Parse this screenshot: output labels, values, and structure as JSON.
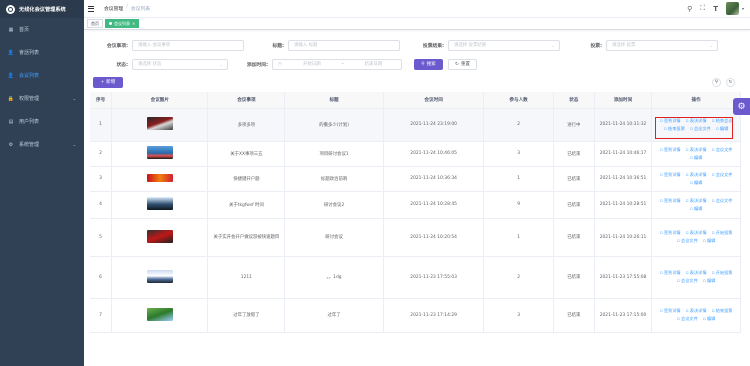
{
  "app": {
    "title": "无线化会议管理系统"
  },
  "sidebar": {
    "items": [
      {
        "label": "首页",
        "icon": "dashboard-icon"
      },
      {
        "label": "會話列表",
        "icon": "user-icon"
      },
      {
        "label": "会议列表",
        "icon": "user-icon",
        "active": true
      },
      {
        "label": "权限管理",
        "icon": "lock-icon",
        "expandable": true
      },
      {
        "label": "用户列表",
        "icon": "document-icon"
      },
      {
        "label": "系统管理",
        "icon": "gear-icon",
        "expandable": true
      }
    ]
  },
  "navbar": {
    "breadcrumb": [
      "会议管理",
      "会议列表"
    ]
  },
  "tags": {
    "home": "首页",
    "active": "会议列表"
  },
  "filters": {
    "meeting_label": "会议事项:",
    "meeting_placeholder": "请输入 会议事项",
    "title_label": "标题:",
    "title_placeholder": "请输入 标题",
    "vote_result_label": "投票结果:",
    "vote_result_placeholder": "请选择 投票结果",
    "vote_label": "投票:",
    "vote_placeholder": "请选择 投票",
    "status_label": "状态:",
    "status_placeholder": "请选择 状态",
    "time_label": "添加时间:",
    "start_placeholder": "开始日期",
    "end_placeholder": "结束日期",
    "range_sep": "-",
    "search_label": "搜索",
    "reset_label": "重置"
  },
  "toolbar": {
    "add_label": "+ 新增"
  },
  "table": {
    "headers": [
      "序号",
      "会议图片",
      "会议事项",
      "标题",
      "会议时间",
      "参与人数",
      "状态",
      "添加时间",
      "操作"
    ],
    "rows": [
      {
        "no": "1",
        "thumb": "t1",
        "item": "多项多项",
        "title": "的撒多少(计划)",
        "time": "2021-11-24 23:19:00",
        "count": "2",
        "status": "进行中",
        "added": "2021-11-24 10:31:32",
        "ops": [
          "签到详情",
          "表决详情",
          "结束会议",
          "结束投票",
          "会议文件",
          "编辑"
        ]
      },
      {
        "no": "2",
        "thumb": "t2",
        "item": "关于XX事项三五",
        "title": "项目研讨会议1",
        "time": "2021-11-24 10:46:05",
        "count": "3",
        "status": "已结束",
        "added": "2021-11-24 10:46:17",
        "ops": [
          "签到详情",
          "表决详情",
          "会议文件",
          "编辑"
        ]
      },
      {
        "no": "3",
        "thumb": "t3",
        "item": "快捷键开户题",
        "title": "标题政治前哨",
        "time": "2021-11-24 10:36:34",
        "count": "1",
        "status": "已结束",
        "added": "2021-11-24 10:36:51",
        "ops": [
          "签到详情",
          "表决详情",
          "会议文件",
          "编辑"
        ]
      },
      {
        "no": "4",
        "thumb": "t4",
        "item": "关于tkgfwsf 时间",
        "title": "研讨会议2",
        "time": "2021-11-24 10:28:45",
        "count": "9",
        "status": "已结束",
        "added": "2021-11-24 10:28:51",
        "ops": [
          "签到详情",
          "表决详情",
          "会议文件",
          "编辑"
        ]
      },
      {
        "no": "5",
        "thumb": "t5",
        "item": "关于实开会开户做议游被快速题目",
        "title": "研讨会议",
        "time": "2021-11-24 10:20:54",
        "count": "1",
        "status": "已结束",
        "added": "2021-11-24 10:26:11",
        "ops": [
          "签到详情",
          "表决详情",
          "开始投票",
          "会议文件",
          "编辑"
        ]
      },
      {
        "no": "6",
        "thumb": "t6",
        "item": "1211",
        "title": "。。1dg",
        "time": "2021-11-23 17:55:03",
        "count": "2",
        "status": "已结束",
        "added": "2021-11-23 17:55:08",
        "ops": [
          "签到详情",
          "表决详情",
          "开始投票",
          "会议文件",
          "编辑"
        ]
      },
      {
        "no": "7",
        "thumb": "t7",
        "item": "过年了放假了",
        "title": "过年了",
        "time": "2021-11-23 17:14:29",
        "count": "3",
        "status": "已结束",
        "added": "2021-11-23 17:15:00",
        "ops": [
          "签到详情",
          "表决详情",
          "结束投票",
          "会议文件",
          "编辑"
        ]
      }
    ]
  },
  "colors": {
    "sidebar_bg": "#304156",
    "primary": "#6a5acd",
    "link": "#409eff",
    "highlight_box": "#e02020",
    "tag_active": "#42b983"
  }
}
